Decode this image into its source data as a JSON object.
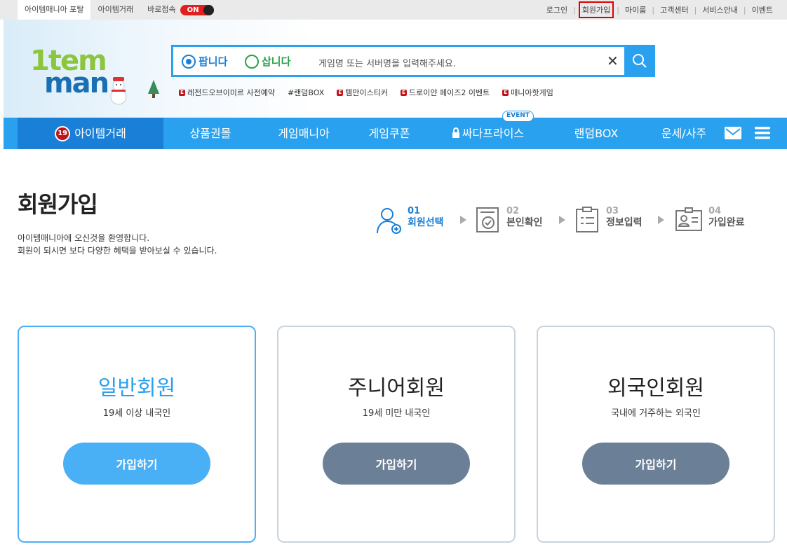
{
  "topbar": {
    "left": [
      "아이템매니아 포탈",
      "아이템거래",
      "바로접속"
    ],
    "toggle": "ON",
    "right": [
      "로그인",
      "회원가입",
      "마이룸",
      "고객센터",
      "서비스안내",
      "이벤트"
    ]
  },
  "search": {
    "sell": "팝니다",
    "buy": "삽니다",
    "placeholder": "게임명 또는 서버명을 입력해주세요."
  },
  "hot_keywords": [
    "레전드오브이미르 사전예약",
    "#랜덤BOX",
    "템만이스티커",
    "드로이얀 페이즈2 이벤트",
    "매니아핫게임"
  ],
  "nav": {
    "badge": "19",
    "items": [
      "아이템거래",
      "상품권몰",
      "게임매니아",
      "게임쿠폰",
      "싸다프라이스",
      "랜덤BOX",
      "운세/사주"
    ],
    "event_badge": "EVENT"
  },
  "page": {
    "title": "회원가입",
    "desc1": "아이템매니아에 오신것을 환영합니다.",
    "desc2": "회원이 되시면 보다 다양한 혜택을 받아보실 수 있습니다."
  },
  "steps": [
    {
      "num": "01",
      "label": "회원선택"
    },
    {
      "num": "02",
      "label": "본인확인"
    },
    {
      "num": "03",
      "label": "정보입력"
    },
    {
      "num": "04",
      "label": "가입완료"
    }
  ],
  "cards": [
    {
      "title": "일반회원",
      "sub": "19세 이상 내국인",
      "button": "가입하기"
    },
    {
      "title": "주니어회원",
      "sub": "19세 미만 내국인",
      "button": "가입하기"
    },
    {
      "title": "외국인회원",
      "sub": "국내에 거주하는 외국인",
      "button": "가입하기"
    }
  ],
  "colors": {
    "brand_blue": "#2aa1ee",
    "nav_active": "#1a7fd6",
    "alert_red": "#c0131a",
    "card_button": "#6b7f96"
  }
}
